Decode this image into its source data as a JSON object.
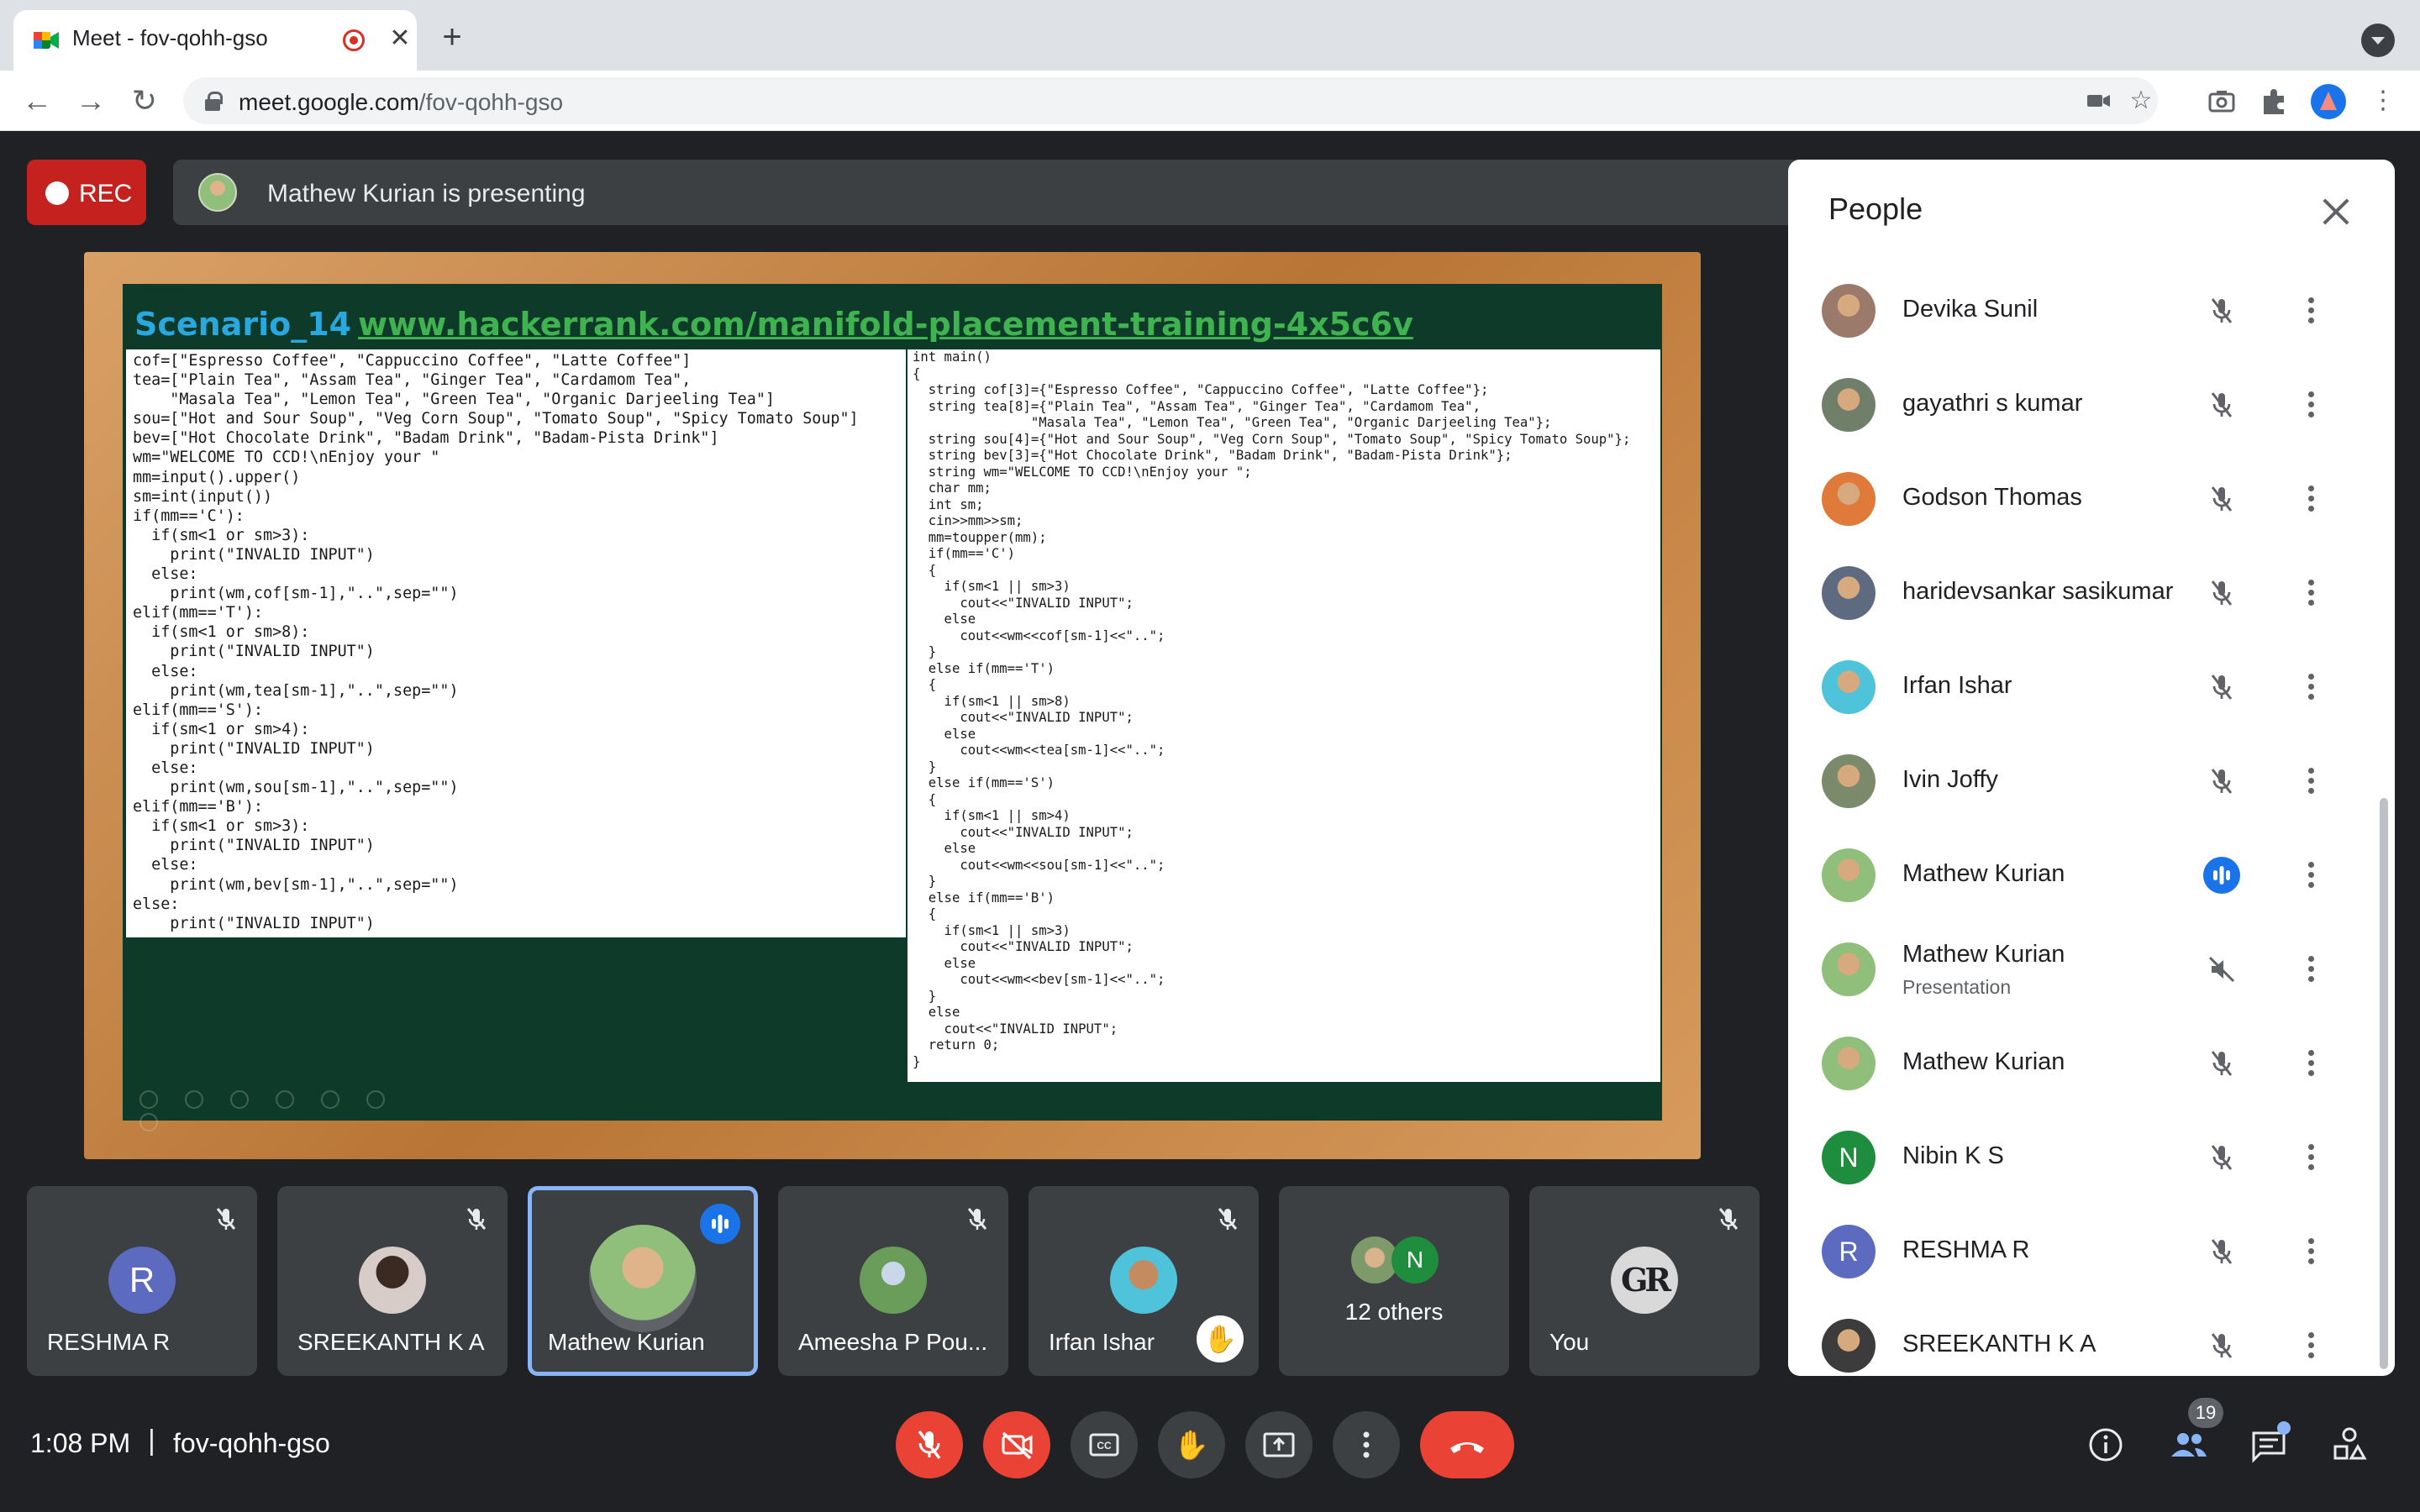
{
  "browser": {
    "tab_title": "Meet - fov-qohh-gso",
    "url_host": "meet.google.com",
    "url_path": "/fov-qohh-gso"
  },
  "meet": {
    "rec_label": "REC",
    "presenting_text": "Mathew Kurian is presenting",
    "time": "1:08 PM",
    "separator": "|",
    "meeting_code": "fov-qohh-gso",
    "participant_count": "19"
  },
  "presentation": {
    "heading": "Scenario_14",
    "link": "www.hackerrank.com/manifold-placement-training-4x5c6v",
    "python_code": "cof=[\"Espresso Coffee\", \"Cappuccino Coffee\", \"Latte Coffee\"]\ntea=[\"Plain Tea\", \"Assam Tea\", \"Ginger Tea\", \"Cardamom Tea\",\n    \"Masala Tea\", \"Lemon Tea\", \"Green Tea\", \"Organic Darjeeling Tea\"]\nsou=[\"Hot and Sour Soup\", \"Veg Corn Soup\", \"Tomato Soup\", \"Spicy Tomato Soup\"]\nbev=[\"Hot Chocolate Drink\", \"Badam Drink\", \"Badam-Pista Drink\"]\nwm=\"WELCOME TO CCD!\\nEnjoy your \"\nmm=input().upper()\nsm=int(input())\nif(mm=='C'):\n  if(sm<1 or sm>3):\n    print(\"INVALID INPUT\")\n  else:\n    print(wm,cof[sm-1],\"..\",sep=\"\")\nelif(mm=='T'):\n  if(sm<1 or sm>8):\n    print(\"INVALID INPUT\")\n  else:\n    print(wm,tea[sm-1],\"..\",sep=\"\")\nelif(mm=='S'):\n  if(sm<1 or sm>4):\n    print(\"INVALID INPUT\")\n  else:\n    print(wm,sou[sm-1],\"..\",sep=\"\")\nelif(mm=='B'):\n  if(sm<1 or sm>3):\n    print(\"INVALID INPUT\")\n  else:\n    print(wm,bev[sm-1],\"..\",sep=\"\")\nelse:\n    print(\"INVALID INPUT\")",
    "cpp_code": "int main()\n{\n  string cof[3]={\"Espresso Coffee\", \"Cappuccino Coffee\", \"Latte Coffee\"};\n  string tea[8]={\"Plain Tea\", \"Assam Tea\", \"Ginger Tea\", \"Cardamom Tea\",\n               \"Masala Tea\", \"Lemon Tea\", \"Green Tea\", \"Organic Darjeeling Tea\"};\n  string sou[4]={\"Hot and Sour Soup\", \"Veg Corn Soup\", \"Tomato Soup\", \"Spicy Tomato Soup\"};\n  string bev[3]={\"Hot Chocolate Drink\", \"Badam Drink\", \"Badam-Pista Drink\"};\n  string wm=\"WELCOME TO CCD!\\nEnjoy your \";\n  char mm;\n  int sm;\n  cin>>mm>>sm;\n  mm=toupper(mm);\n  if(mm=='C')\n  {\n    if(sm<1 || sm>3)\n      cout<<\"INVALID INPUT\";\n    else\n      cout<<wm<<cof[sm-1]<<\"..\";\n  }\n  else if(mm=='T')\n  {\n    if(sm<1 || sm>8)\n      cout<<\"INVALID INPUT\";\n    else\n      cout<<wm<<tea[sm-1]<<\"..\";\n  }\n  else if(mm=='S')\n  {\n    if(sm<1 || sm>4)\n      cout<<\"INVALID INPUT\";\n    else\n      cout<<wm<<sou[sm-1]<<\"..\";\n  }\n  else if(mm=='B')\n  {\n    if(sm<1 || sm>3)\n      cout<<\"INVALID INPUT\";\n    else\n      cout<<wm<<bev[sm-1]<<\"..\";\n  }\n  else\n    cout<<\"INVALID INPUT\";\n  return 0;\n}"
  },
  "tiles": [
    {
      "name": "RESHMA R",
      "initial": "R",
      "avatar_color": "#5c6bc0",
      "state": "muted"
    },
    {
      "name": "SREEKANTH K A",
      "initial": "",
      "avatar_color": "#d7ccc8",
      "state": "muted"
    },
    {
      "name": "Mathew Kurian",
      "initial": "",
      "avatar_color": "#8fbf7a",
      "state": "speaking"
    },
    {
      "name": "Ameesha P Pou...",
      "initial": "",
      "avatar_color": "#6a9c5a",
      "state": "muted"
    },
    {
      "name": "Irfan Ishar",
      "initial": "",
      "avatar_color": "#4fc3d9",
      "state": "muted",
      "hand_raised": true
    },
    {
      "name": "",
      "others": "12 others",
      "mini_initial": "N",
      "mini_color": "#1e8e3e"
    },
    {
      "name": "You",
      "initial": "GR",
      "avatar_color": "#202124",
      "state": "muted"
    }
  ],
  "people_panel": {
    "title": "People",
    "people": [
      {
        "name": "Devika Sunil",
        "initial": "",
        "avatar_color": "#9c7a6b",
        "status": "muted"
      },
      {
        "name": "gayathri s kumar",
        "initial": "",
        "avatar_color": "#6f7f6a",
        "status": "muted"
      },
      {
        "name": "Godson Thomas",
        "initial": "",
        "avatar_color": "#e07a3a",
        "status": "muted"
      },
      {
        "name": "haridevsankar sasikumar",
        "initial": "",
        "avatar_color": "#5e6a80",
        "status": "muted"
      },
      {
        "name": "Irfan Ishar",
        "initial": "",
        "avatar_color": "#4fc3d9",
        "status": "muted"
      },
      {
        "name": "Ivin Joffy",
        "initial": "",
        "avatar_color": "#7a8a6a",
        "status": "muted"
      },
      {
        "name": "Mathew Kurian",
        "initial": "",
        "avatar_color": "#8fbf7a",
        "status": "speaking"
      },
      {
        "name": "Mathew Kurian",
        "subtitle": "Presentation",
        "initial": "",
        "avatar_color": "#8fbf7a",
        "status": "presentation-muted"
      },
      {
        "name": "Mathew Kurian",
        "initial": "",
        "avatar_color": "#8fbf7a",
        "status": "muted"
      },
      {
        "name": "Nibin K S",
        "initial": "N",
        "avatar_color": "#1e8e3e",
        "status": "muted"
      },
      {
        "name": "RESHMA R",
        "initial": "R",
        "avatar_color": "#5c6bc0",
        "status": "muted"
      },
      {
        "name": "SREEKANTH K A",
        "initial": "",
        "avatar_color": "#3c3c3c",
        "status": "muted"
      }
    ]
  },
  "icons": {
    "mic_off": "mic-off-icon",
    "camera_off": "camera-off-icon",
    "captions": "closed-captions-icon",
    "raise_hand": "raise-hand-icon",
    "present": "present-now-icon",
    "more": "more-options-icon",
    "end_call": "end-call-icon",
    "info": "meeting-details-icon",
    "people": "people-icon",
    "chat": "chat-icon",
    "activities": "activities-icon"
  },
  "colors": {
    "meet_bg": "#202124",
    "tile_bg": "#3c4043",
    "danger": "#ea4335",
    "accent": "#1a73e8",
    "active_border": "#8ab4f8"
  }
}
